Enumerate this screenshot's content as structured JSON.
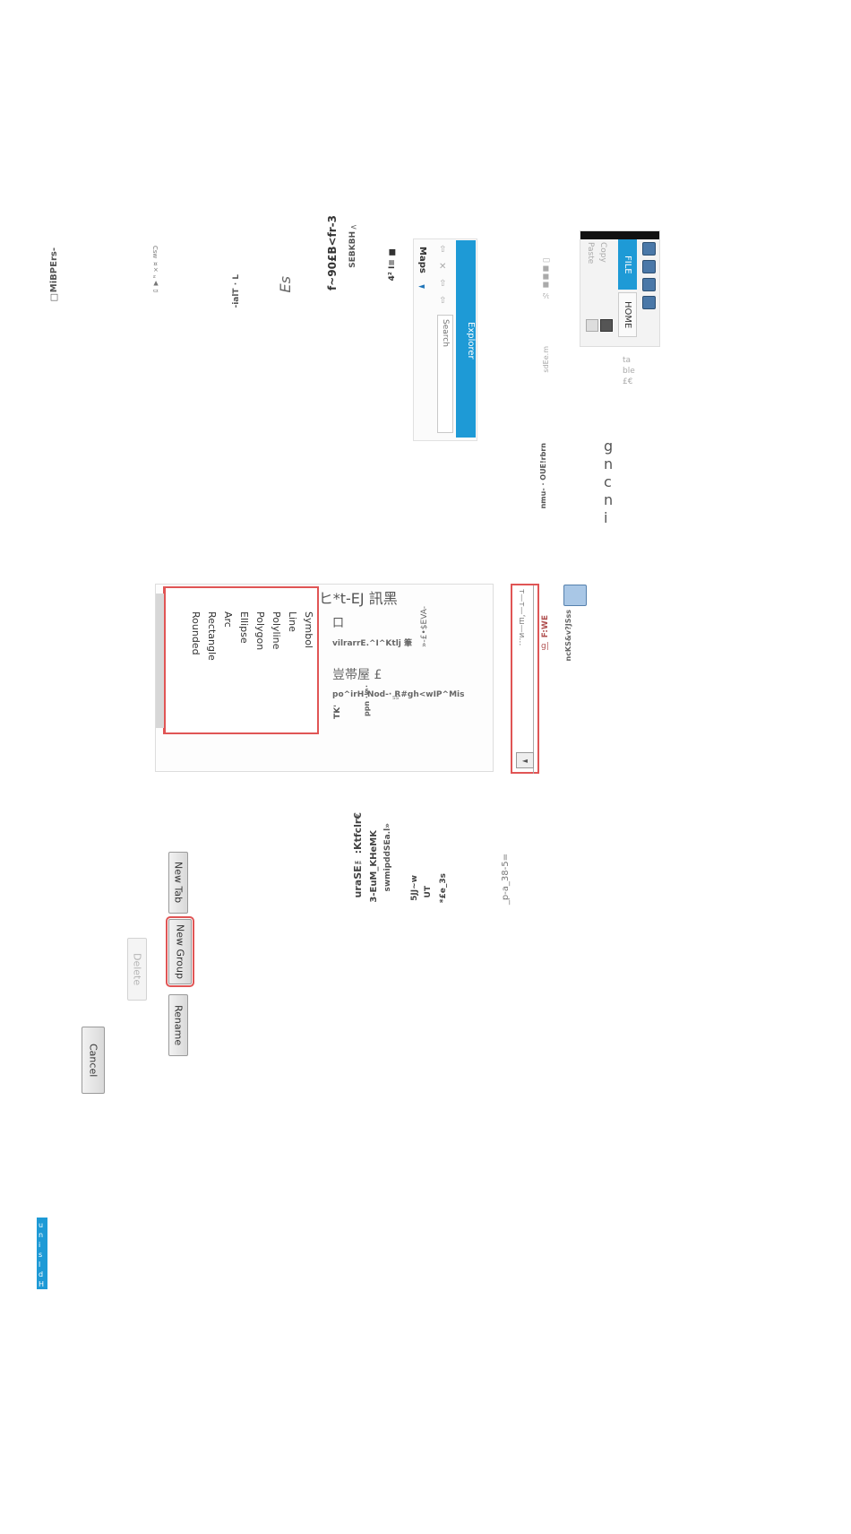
{
  "labels": {
    "mibpers": "□MiBPErs-",
    "tiny_top": "Csw",
    "tiny_top2": "ﾛ ▼ ᴺ ×¤",
    "ialt": "-ialT · L",
    "es": "Es",
    "f90": "f~90£B<fr-3",
    "sebkbh": "SEBKBH",
    "sebk_arrow": "<",
    "izm": "4² I≡ ■"
  },
  "ribbon": {
    "file_label": "FILE",
    "home_label": "HOME",
    "clipboard_copy": "Copy",
    "clipboard_paste": "Paste",
    "ribbon_left_text": "½ ■■■ ゙",
    "sdee": "sdEe.m",
    "table_text": "ta ble £€",
    "nmu": "nmu- · OUE!rbrn",
    "gncni": "g n c n i M"
  },
  "explorer": {
    "title": "Explorer",
    "search_placeholder": "Search",
    "maps_label": "Maps",
    "maps_arrow": "◄"
  },
  "shapes": {
    "header_glyphs": "Cl□┴ 0ÞU ⅃ T 同 O ヒ*t-EJ 訊黑",
    "items": [
      "Symbol",
      "Line",
      "Polyline",
      "Polygon",
      "Ellipse",
      "Arc",
      "Rectangle",
      "Rounded"
    ],
    "glyph_box": "口",
    "vilrarr": "vilrarrE.^I^Ktlj 筆",
    "eva": "»-£•$EVA-",
    "tokenya": "豈帯屋 £",
    "por": "po^irH-Nod-· R#gh<wIP^Mis",
    "ppn": "ppn ·§·",
    "tk": "TK'",
    "ss": "ss"
  },
  "right_list": {
    "scroll_arrow": "◄",
    "fwe": "F:WE",
    "gl": "g|",
    "list_text": "т—т—‘ш—и…",
    "ncks": "ncKS&v?JSss"
  },
  "buttons": {
    "new_tab": "New Tab",
    "new_group": "New Group",
    "delete": "Delete",
    "rename": "Rename",
    "cancel": "Cancel"
  },
  "mid_text": {
    "urase": "uraSE™:Ktfclr€",
    "eum": "3-EuM_KHeMK",
    "smip": "swmipddSEa.l»",
    "sjj": "5JJ~w",
    "ut": "UT",
    "e3s": "*£e_3s",
    "pa38": "_p-a_38-5="
  },
  "badge": {
    "text": "u n i s l d H M · ℹ"
  },
  "colors": {
    "accent_blue": "#1e9ad6",
    "focus_red": "#e05555"
  }
}
